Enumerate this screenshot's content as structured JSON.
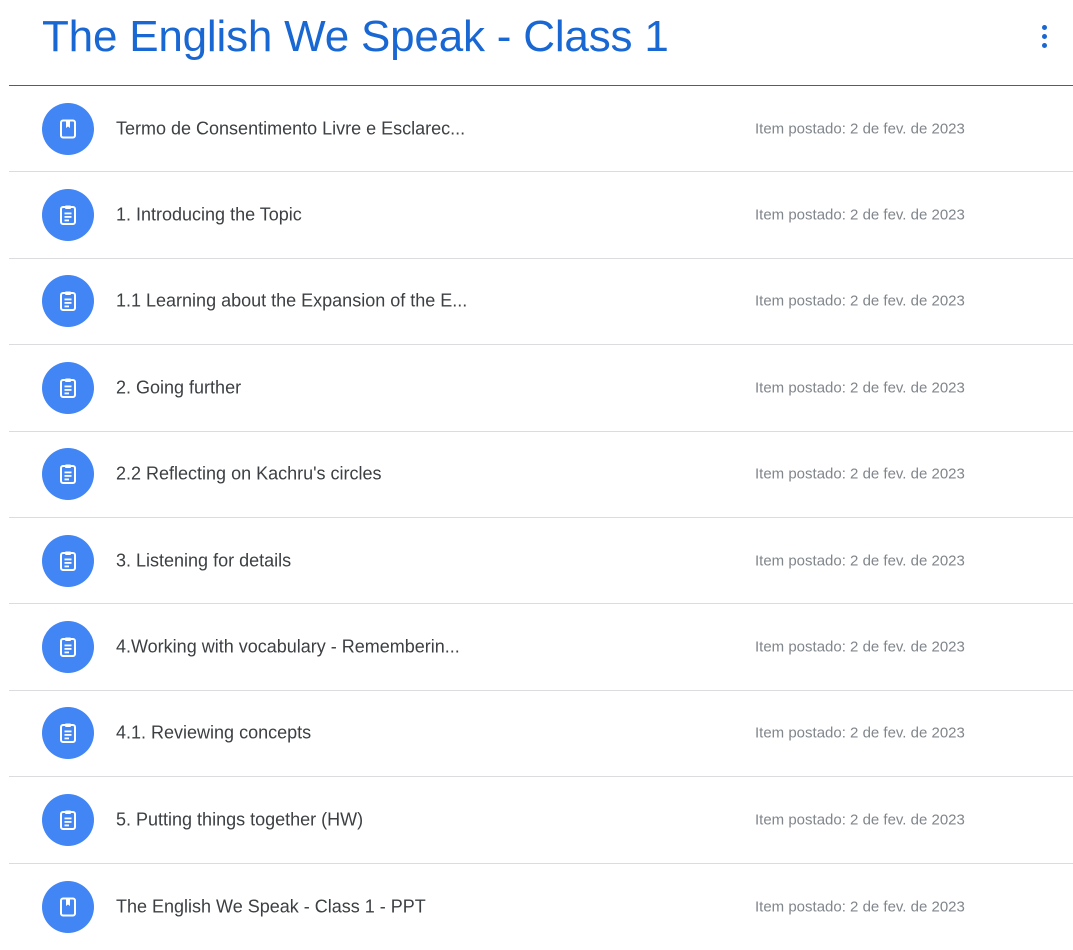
{
  "header": {
    "title": "The English We Speak - Class 1",
    "accent_color": "#1967d2"
  },
  "list": {
    "icon_background": "#4285f4",
    "items": [
      {
        "title": "Termo de Consentimento Livre e Esclarec...",
        "posted": "Item postado: 2 de fev. de 2023",
        "icon": "book-icon"
      },
      {
        "title": "1. Introducing the Topic",
        "posted": "Item postado: 2 de fev. de 2023",
        "icon": "assignment-icon"
      },
      {
        "title": "1.1 Learning about the Expansion of the E...",
        "posted": "Item postado: 2 de fev. de 2023",
        "icon": "assignment-icon"
      },
      {
        "title": "2. Going further",
        "posted": "Item postado: 2 de fev. de 2023",
        "icon": "assignment-icon"
      },
      {
        "title": "2.2 Reflecting on Kachru's circles",
        "posted": "Item postado: 2 de fev. de 2023",
        "icon": "assignment-icon"
      },
      {
        "title": "3. Listening for details",
        "posted": "Item postado: 2 de fev. de 2023",
        "icon": "assignment-icon"
      },
      {
        "title": "4.Working with vocabulary - Rememberin...",
        "posted": "Item postado: 2 de fev. de 2023",
        "icon": "assignment-icon"
      },
      {
        "title": "4.1. Reviewing concepts",
        "posted": "Item postado: 2 de fev. de 2023",
        "icon": "assignment-icon"
      },
      {
        "title": "5. Putting things together (HW)",
        "posted": "Item postado: 2 de fev. de 2023",
        "icon": "assignment-icon"
      },
      {
        "title": "The English We Speak - Class 1 - PPT",
        "posted": "Item postado: 2 de fev. de 2023",
        "icon": "book-icon"
      }
    ]
  }
}
